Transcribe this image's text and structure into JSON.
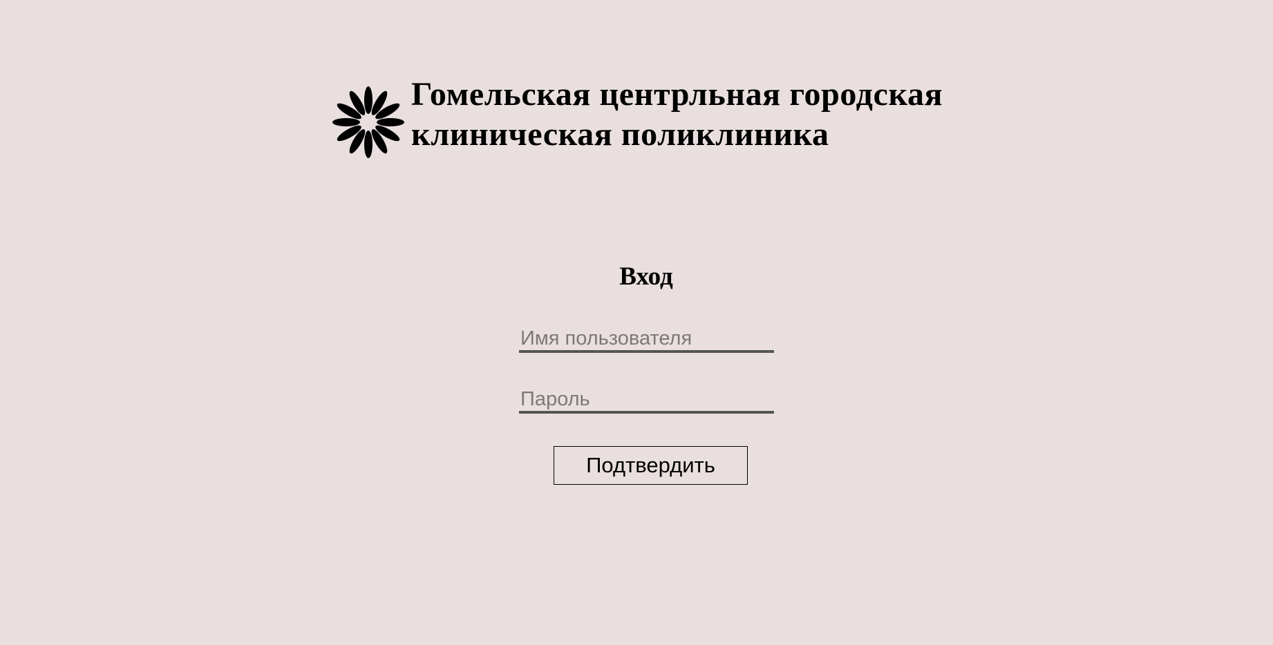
{
  "header": {
    "logo_icon": "daisy-flower-icon",
    "title_line1": "Гомельская центрльная городская",
    "title_line2": "клиническая поликлиника"
  },
  "login": {
    "heading": "Вход",
    "username_placeholder": "Имя пользователя",
    "username_value": "",
    "password_placeholder": "Пароль",
    "password_value": "",
    "submit_label": "Подтвердить"
  },
  "colors": {
    "background": "#e9dfde",
    "field_underline": "#555555",
    "placeholder": "#7d7878"
  }
}
